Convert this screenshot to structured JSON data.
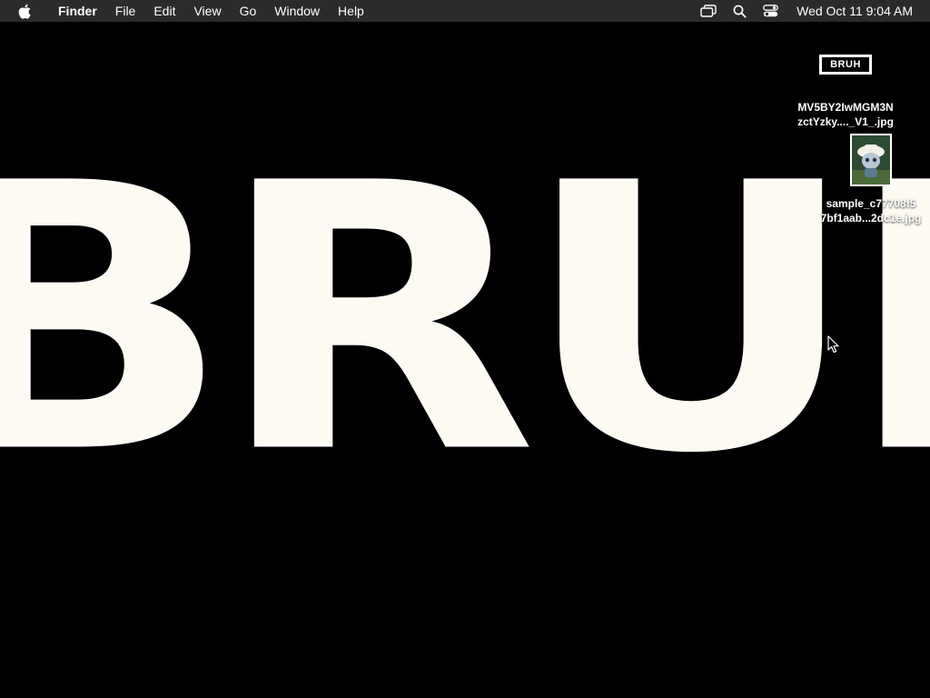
{
  "menubar": {
    "apple_icon": "apple-logo-icon",
    "app_name": "Finder",
    "menus": [
      "File",
      "Edit",
      "View",
      "Go",
      "Window",
      "Help"
    ],
    "status_icons": [
      "screen-mirroring-icon",
      "spotlight-search-icon",
      "control-center-icon"
    ],
    "clock": "Wed Oct 11  9:04 AM"
  },
  "wallpaper": {
    "text": "BRUH",
    "text_color": "#fdfaf4",
    "background_color": "#000000"
  },
  "desktop_icons": [
    {
      "thumb_text": "BRUH",
      "label_line1": "MV5BY2IwMGM3N",
      "label_line2": "zctYzky...._V1_.jpg"
    },
    {
      "label_line1": "sample_c77708f5",
      "label_line2": "7bf1aab...2dc1e.jpg"
    }
  ]
}
